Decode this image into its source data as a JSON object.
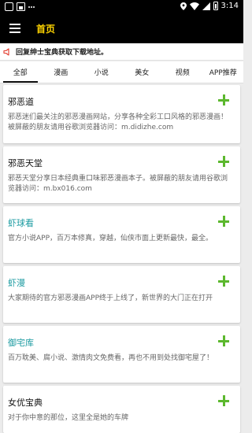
{
  "status": {
    "time": "3:14"
  },
  "appbar": {
    "title": "首页"
  },
  "notice": {
    "text": "回复绅士宝典获取下载地址。"
  },
  "tabs": [
    {
      "label": "全部"
    },
    {
      "label": "漫画"
    },
    {
      "label": "小说"
    },
    {
      "label": "美女"
    },
    {
      "label": "视频"
    },
    {
      "label": "APP推荐"
    }
  ],
  "colors": {
    "title_dark": "#111111",
    "title_teal": "#1a9aa0",
    "add_green": "#5cb82e",
    "appbar_title": "#ffd400"
  },
  "cards": [
    {
      "title": "邪恶道",
      "desc": "邪恶迷们最关注的邪恶漫画网站，分享各种全彩工口风格的邪恶漫画！被屏蔽的朋友请用谷歌浏览器访问：m.didizhe.com",
      "title_color": "#111111"
    },
    {
      "title": "邪恶天堂",
      "desc": "邪恶天堂分享日本经典重口味邪恶漫画本子。被屏蔽的朋友请用谷歌浏览器访问：m.bx016.com",
      "title_color": "#111111"
    },
    {
      "title": "虾球看",
      "desc": "官方小说APP，百万本修真，穿越，仙侠市面上更新最快，最全。",
      "title_color": "#1a9aa0"
    },
    {
      "title": "虾漫",
      "desc": "大家期待的官方邪恶漫画APP终于上线了，新世界的大门正在打开",
      "title_color": "#1a9aa0"
    },
    {
      "title": "御宅库",
      "desc": "百万耽美、腐小说、激情肉文免费看，再也不用到处找御宅屋了！",
      "title_color": "#1a9aa0"
    },
    {
      "title": "女优宝典",
      "desc": "对于你中意的那位，这里全是她的车牌",
      "title_color": "#111111"
    }
  ]
}
